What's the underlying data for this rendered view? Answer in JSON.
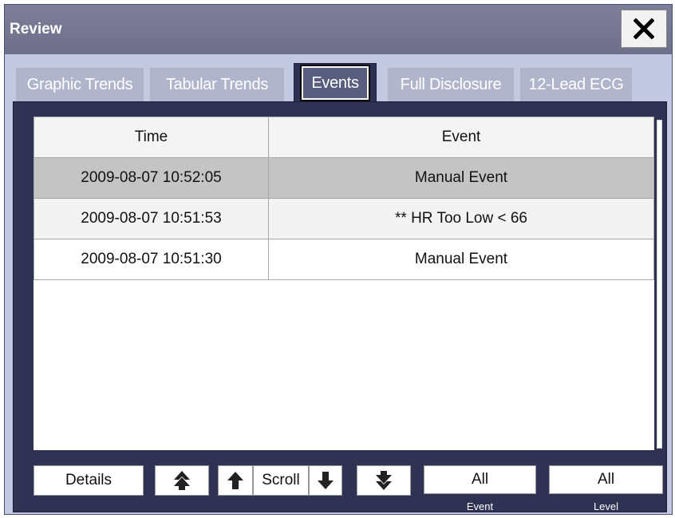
{
  "window": {
    "title": "Review"
  },
  "tabs": [
    {
      "label": "Graphic Trends"
    },
    {
      "label": "Tabular Trends"
    },
    {
      "label": "Events"
    },
    {
      "label": "Full Disclosure"
    },
    {
      "label": "12-Lead ECG"
    }
  ],
  "table": {
    "headers": [
      "Time",
      "Event"
    ],
    "rows": [
      {
        "time": "2009-08-07 10:52:05",
        "event": "Manual Event"
      },
      {
        "time": "2009-08-07 10:51:53",
        "event": "** HR Too Low < 66"
      },
      {
        "time": "2009-08-07 10:51:30",
        "event": "Manual Event"
      }
    ]
  },
  "buttons": {
    "details": "Details",
    "scroll": "Scroll",
    "event_filter": {
      "value": "All",
      "caption": "Event"
    },
    "level_filter": {
      "value": "All",
      "caption": "Level"
    }
  },
  "icons": {
    "close": "close-icon",
    "page_up": "double-up-arrow-icon",
    "up": "up-arrow-icon",
    "down": "down-arrow-icon",
    "page_down": "double-down-arrow-icon"
  },
  "colors": {
    "title_bar": "#6e6f8a",
    "panel": "#2f3253",
    "selected_row": "#c4c4c4",
    "inactive_tab": "#b0b5cc"
  }
}
